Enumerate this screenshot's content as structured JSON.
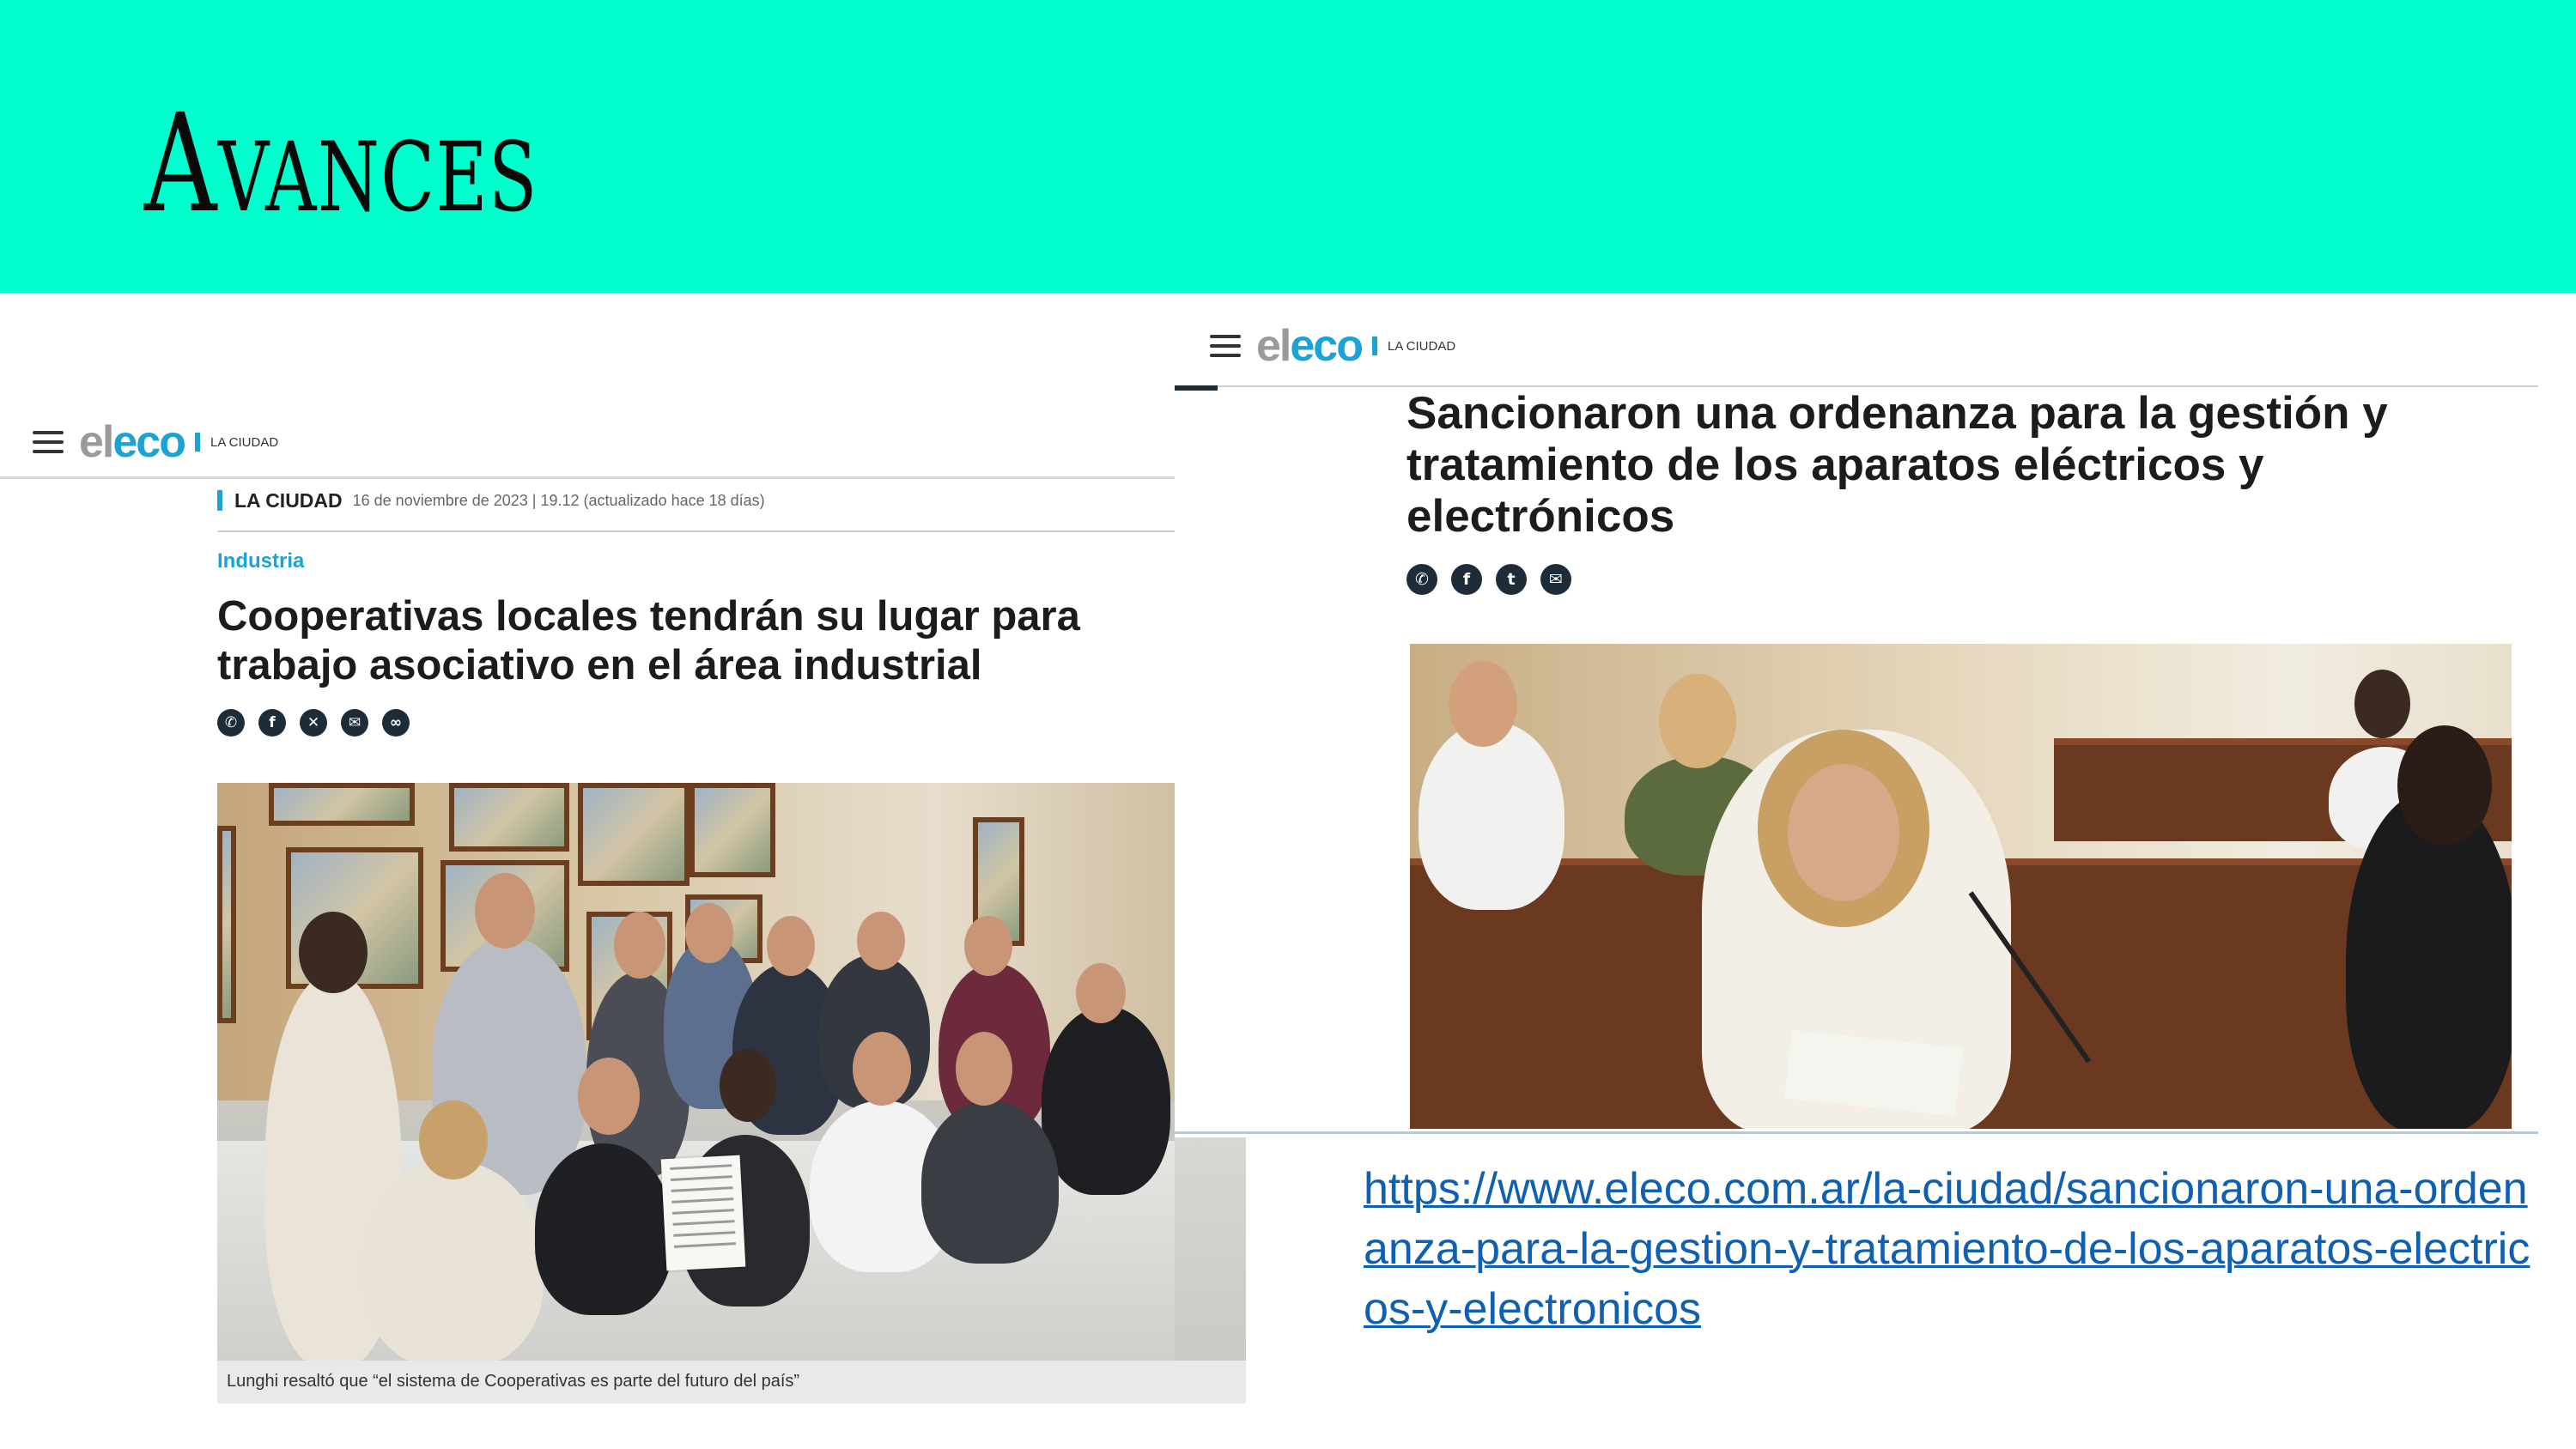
{
  "slide": {
    "title": "Avances",
    "band_color": "#00ffcc"
  },
  "left_article": {
    "logo_el": "el",
    "logo_eco": "eco",
    "section_tag": "LA CIUDAD",
    "meta_section": "LA CIUDAD",
    "meta_date": "16 de noviembre de 2023 | 19.12 (actualizado hace 18 días)",
    "category": "Industria",
    "headline": "Cooperativas locales tendrán su lugar para trabajo asociativo en el área industrial",
    "share_icons": [
      "whatsapp-icon",
      "facebook-icon",
      "x-icon",
      "email-icon",
      "link-icon"
    ],
    "caption": "Lunghi resaltó que “el sistema de Cooperativas es parte del futuro del país”"
  },
  "right_article": {
    "logo_el": "el",
    "logo_eco": "eco",
    "section_tag": "LA CIUDAD",
    "headline": "Sancionaron una ordenanza para la gestión y tratamiento de los aparatos eléctricos y electrónicos",
    "share_icons": [
      "whatsapp-icon",
      "facebook-icon",
      "twitter-icon",
      "email-icon"
    ],
    "url": "https://www.eleco.com.ar/la-ciudad/sancionaron-una-ordenanza-para-la-gestion-y-tratamiento-de-los-aparatos-electricos-y-electronicos"
  },
  "colors": {
    "accent_blue": "#1aa3d4",
    "link_blue": "#0f5fb3",
    "icon_dark": "#1e2c3a"
  }
}
